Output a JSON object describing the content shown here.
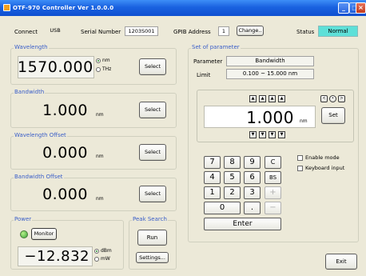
{
  "window": {
    "title": "OTF-970 Controller  Ver 1.0.0.0"
  },
  "header": {
    "connect_label": "Connect",
    "connect_value": "USB",
    "serial_label": "Serial Number",
    "serial_value": "1203S001",
    "gpib_label": "GPIB Address",
    "gpib_value": "1",
    "change_button": "Change..",
    "status_label": "Status",
    "status_value": "Normal"
  },
  "wavelength": {
    "label": "Wavelength",
    "value": "1570.000",
    "unit_options": [
      "nm",
      "THz"
    ],
    "selected_unit": "nm",
    "select_button": "Select"
  },
  "bandwidth": {
    "label": "Bandwidth",
    "value": "1.000",
    "unit": "nm",
    "select_button": "Select"
  },
  "wavelength_offset": {
    "label": "Wavelength Offset",
    "value": "0.000",
    "unit": "nm",
    "select_button": "Select"
  },
  "bandwidth_offset": {
    "label": "Bandwidth Offset",
    "value": "0.000",
    "unit": "nm",
    "select_button": "Select"
  },
  "power": {
    "label": "Power",
    "monitor_button": "Monitor",
    "value": "−12.832",
    "unit_options": [
      "dBm",
      "mW"
    ],
    "selected_unit": "dBm"
  },
  "peak_search": {
    "label": "Peak Search",
    "run_button": "Run",
    "settings_button": "Settings..."
  },
  "set_parameter": {
    "label": "Set of parameter",
    "parameter_label": "Parameter",
    "parameter_value": "Bandwidth",
    "limit_label": "Limit",
    "limit_value": "0.100 ~ 15.000  nm",
    "display_value": "1.000",
    "display_unit": "nm",
    "set_button": "Set"
  },
  "keypad": {
    "keys": [
      "7",
      "8",
      "9",
      "C",
      "4",
      "5",
      "6",
      "BS",
      "1",
      "2",
      "3",
      "+",
      "0",
      ".",
      "−"
    ],
    "enter": "Enter"
  },
  "options": {
    "enable_mode": "Enable mode",
    "keyboard_input": "Keyboard input"
  },
  "exit_button": "Exit"
}
